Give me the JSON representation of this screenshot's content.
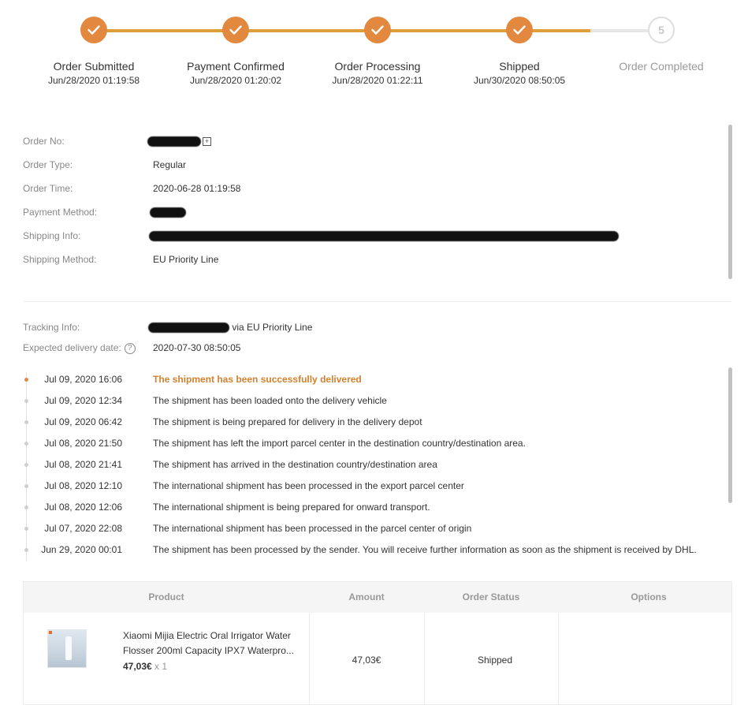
{
  "progress": {
    "steps": [
      {
        "label": "Order Submitted",
        "time": "Jun/28/2020 01:19:58",
        "done": true
      },
      {
        "label": "Payment Confirmed",
        "time": "Jun/28/2020 01:20:02",
        "done": true
      },
      {
        "label": "Order Processing",
        "time": "Jun/28/2020 01:22:11",
        "done": true
      },
      {
        "label": "Shipped",
        "time": "Jun/30/2020 08:50:05",
        "done": true
      },
      {
        "label": "Order Completed",
        "time": "",
        "done": false,
        "number": "5"
      }
    ]
  },
  "order_info": {
    "order_no_label": "Order No:",
    "order_type_label": "Order Type:",
    "order_type": "Regular",
    "order_time_label": "Order Time:",
    "order_time": "2020-06-28 01:19:58",
    "payment_method_label": "Payment Method:",
    "shipping_info_label": "Shipping Info:",
    "shipping_method_label": "Shipping Method:",
    "shipping_method": "EU Priority Line"
  },
  "tracking": {
    "tracking_info_label": "Tracking Info:",
    "via_text": "via EU Priority Line",
    "expected_label": "Expected delivery date:",
    "expected_date": "2020-07-30 08:50:05",
    "events": [
      {
        "date": "Jul 09, 2020 16:06",
        "desc": "The shipment has been successfully delivered"
      },
      {
        "date": "Jul 09, 2020 12:34",
        "desc": "The shipment has been loaded onto the delivery vehicle"
      },
      {
        "date": "Jul 09, 2020 06:42",
        "desc": "The shipment is being prepared for delivery in the delivery depot"
      },
      {
        "date": "Jul 08, 2020 21:50",
        "desc": "The shipment has left the import parcel center in the destination country/destination area."
      },
      {
        "date": "Jul 08, 2020 21:41",
        "desc": "The shipment has arrived in the destination country/destination area"
      },
      {
        "date": "Jul 08, 2020 12:10",
        "desc": "The international shipment has been processed in the export parcel center"
      },
      {
        "date": "Jul 08, 2020 12:06",
        "desc": "The international shipment is being prepared for onward transport."
      },
      {
        "date": "Jul 07, 2020 22:08",
        "desc": "The international shipment has been processed in the parcel center of origin"
      },
      {
        "date": "Jun 29, 2020 00:01",
        "desc": "The shipment has been processed by the sender. You will receive further information as soon as the shipment is received by DHL."
      }
    ]
  },
  "table": {
    "headers": [
      "Product",
      "Amount",
      "Order Status",
      "Options"
    ],
    "rows": [
      {
        "product_name": "Xiaomi Mijia Electric Oral Irrigator Water Flosser 200ml Capacity IPX7 Waterpro...",
        "unit_price": "47,03€",
        "quantity": "x 1",
        "amount": "47,03€",
        "status": "Shipped"
      }
    ]
  },
  "colors": {
    "accent": "#e2883f",
    "progress_line": "#de9f3a",
    "highlight_text": "#d2812d"
  }
}
